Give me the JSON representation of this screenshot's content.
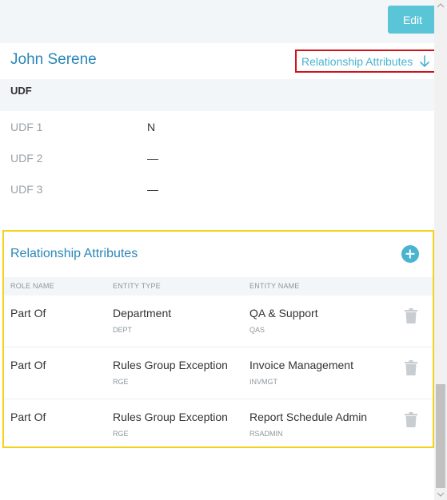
{
  "toolbar": {
    "edit_label": "Edit"
  },
  "header": {
    "name": "John Serene",
    "relationship_link": "Relationship Attributes"
  },
  "udf": {
    "title": "UDF",
    "rows": [
      {
        "label": "UDF 1",
        "value": "N"
      },
      {
        "label": "UDF 2",
        "value": "—"
      },
      {
        "label": "UDF 3",
        "value": "—"
      }
    ]
  },
  "relationships": {
    "title": "Relationship Attributes",
    "columns": [
      "ROLE NAME",
      "ENTITY TYPE",
      "ENTITY NAME"
    ],
    "rows": [
      {
        "role": "Part Of",
        "entity_type": "Department",
        "entity_type_code": "DEPT",
        "entity_name": "QA & Support",
        "entity_name_code": "QAS"
      },
      {
        "role": "Part Of",
        "entity_type": "Rules Group Exception",
        "entity_type_code": "RGE",
        "entity_name": "Invoice Management",
        "entity_name_code": "INVMGT"
      },
      {
        "role": "Part Of",
        "entity_type": "Rules Group Exception",
        "entity_type_code": "RGE",
        "entity_name": "Report Schedule Admin",
        "entity_name_code": "RSADMIN"
      }
    ]
  },
  "colors": {
    "accent": "#2a86b8",
    "button": "#5bc5d8",
    "highlight_red": "#d0121a",
    "highlight_yellow": "#f4d21c"
  },
  "icons": {
    "link_arrow": "arrow-down-icon",
    "add": "plus-circle-icon",
    "delete": "trash-icon"
  }
}
